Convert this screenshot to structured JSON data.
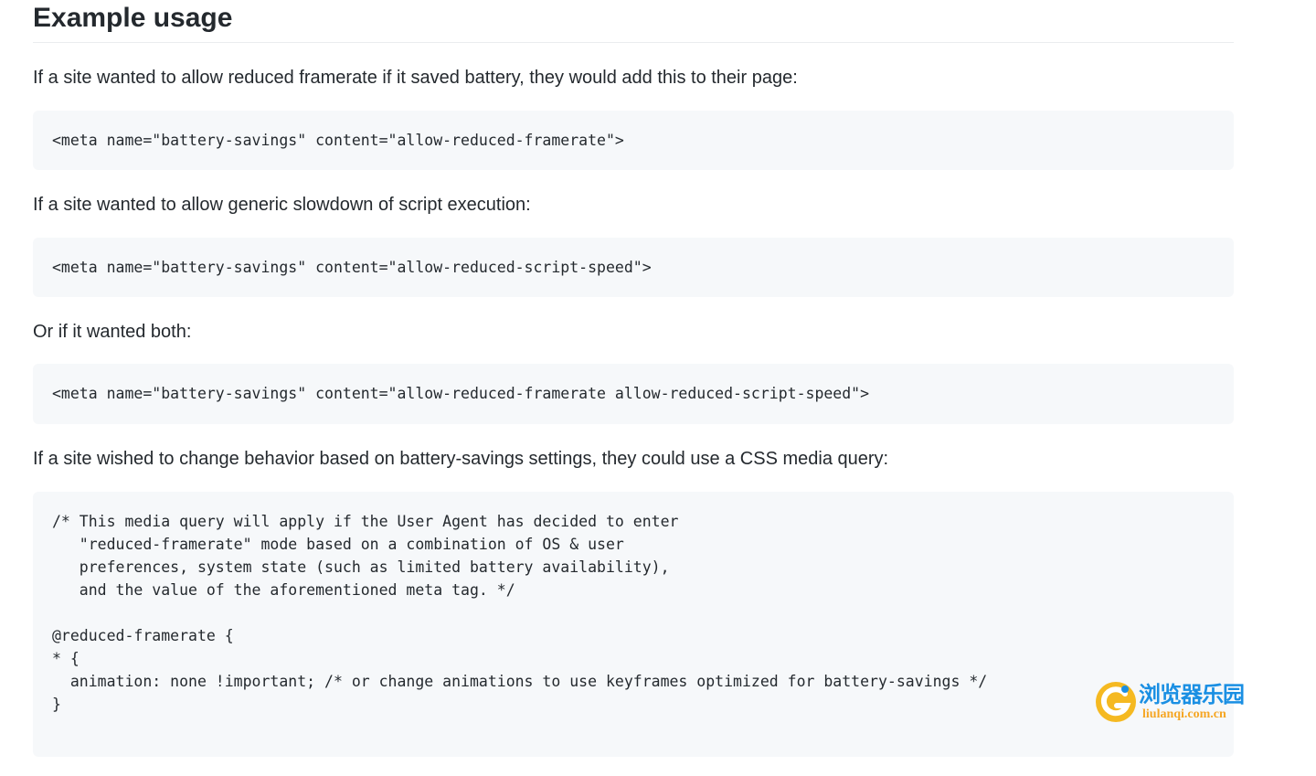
{
  "section": {
    "heading": "Example usage"
  },
  "content": {
    "para1": "If a site wanted to allow reduced framerate if it saved battery, they would add this to their page:",
    "code1": "<meta name=\"battery-savings\" content=\"allow-reduced-framerate\">",
    "para2": "If a site wanted to allow generic slowdown of script execution:",
    "code2": "<meta name=\"battery-savings\" content=\"allow-reduced-script-speed\">",
    "para3": "Or if it wanted both:",
    "code3": "<meta name=\"battery-savings\" content=\"allow-reduced-framerate allow-reduced-script-speed\">",
    "para4": "If a site wished to change behavior based on battery-savings settings, they could use a CSS media query:",
    "code4": "/* This media query will apply if the User Agent has decided to enter\n   \"reduced-framerate\" mode based on a combination of OS & user\n   preferences, system state (such as limited battery availability),\n   and the value of the aforementioned meta tag. */\n\n@reduced-framerate {\n* {\n  animation: none !important; /* or change animations to use keyframes optimized for battery-savings */\n}"
  },
  "watermark": {
    "title": "浏览器乐园",
    "url": "liulanqi.com.cn",
    "title_color": "#1a8fe3",
    "logo_color": "#f5b921"
  },
  "colors": {
    "text": "#24292e",
    "code_background": "#f6f8fa",
    "heading_rule": "#eaecef"
  }
}
